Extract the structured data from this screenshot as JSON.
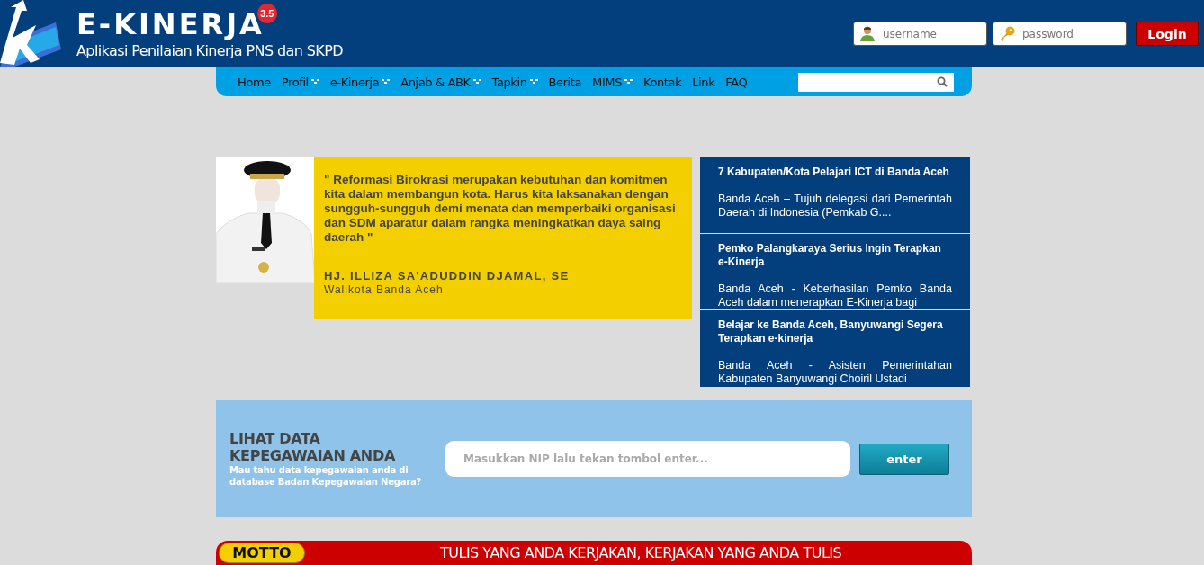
{
  "header": {
    "title": "E-KINERJA",
    "version_badge": "3.5",
    "subtitle": "Aplikasi Penilaian Kinerja PNS dan SKPD",
    "login": {
      "username_placeholder": "username",
      "password_placeholder": "password",
      "button": "Login"
    }
  },
  "nav": {
    "items": [
      {
        "label": "Home",
        "has_menu": false
      },
      {
        "label": "Profil",
        "has_menu": true
      },
      {
        "label": "e-Kinerja",
        "has_menu": true
      },
      {
        "label": "Anjab & ABK",
        "has_menu": true
      },
      {
        "label": "Tapkin",
        "has_menu": true
      },
      {
        "label": "Berita",
        "has_menu": false
      },
      {
        "label": "MIMS",
        "has_menu": true
      },
      {
        "label": "Kontak",
        "has_menu": false
      },
      {
        "label": "Link",
        "has_menu": false
      },
      {
        "label": "FAQ",
        "has_menu": false
      }
    ]
  },
  "quote": {
    "text": "\" Reformasi Birokrasi merupakan kebutuhan dan komitmen kita dalam membangun kota. Harus kita laksanakan dengan sungguh-sungguh demi menata dan memperbaiki organisasi dan SDM aparatur dalam rangka meningkatkan daya saing daerah \"",
    "name": "HJ. ILLIZA SA'ADUDDIN DJAMAL, SE",
    "role": "Walikota Banda Aceh"
  },
  "news": [
    {
      "title": "7 Kabupaten/Kota Pelajari ICT di Banda Aceh",
      "excerpt": "Banda Aceh – Tujuh delegasi dari Pemerintah Daerah di Indonesia (Pemkab G...."
    },
    {
      "title": "Pemko Palangkaraya Serius Ingin Terapkan e-Kinerja",
      "excerpt": "Banda Aceh - Keberhasilan Pemko Banda Aceh dalam menerapkan E-Kinerja bagi"
    },
    {
      "title": "Belajar ke Banda Aceh, Banyuwangi Segera Terapkan e-kinerja",
      "excerpt": "Banda Aceh - Asisten Pemerintahan Kabupaten Banyuwangi Choiril Ustadi"
    }
  ],
  "nip_search": {
    "title": "LIHAT DATA KEPEGAWAIAN ANDA",
    "subtitle": "Mau tahu data kepegawaian anda di database Badan Kepegawaian Negara?",
    "placeholder": "Masukkan NIP lalu tekan tombol enter...",
    "button": "enter"
  },
  "motto": {
    "label": "MOTTO",
    "text": "TULIS YANG ANDA KERJAKAN, KERJAKAN YANG ANDA TULIS"
  }
}
